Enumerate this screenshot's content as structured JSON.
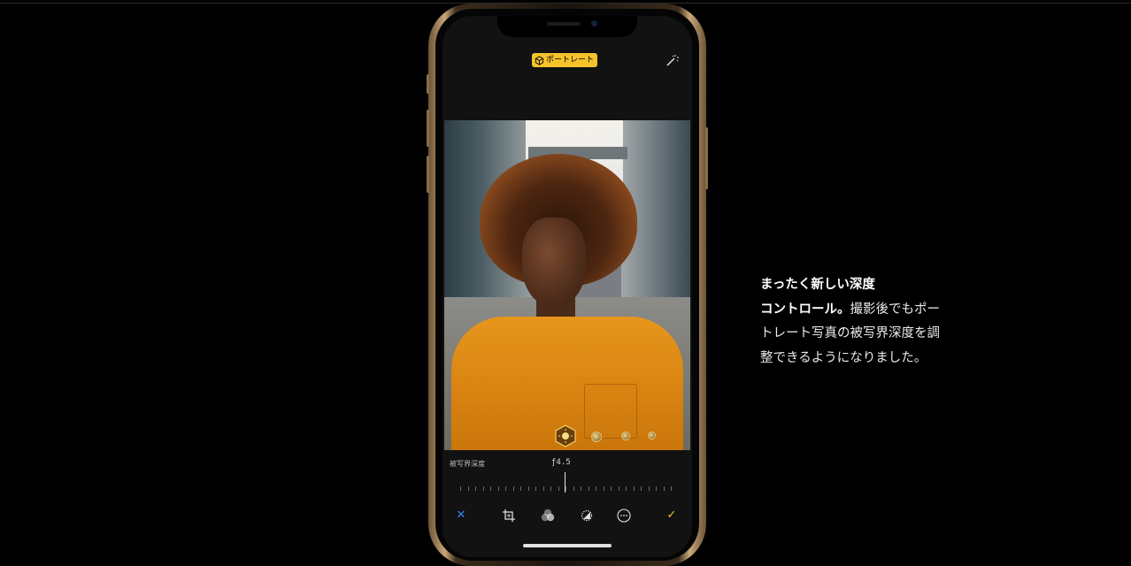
{
  "viewer": {
    "mode_badge": "ポートレート",
    "auto_enhance_icon": "magic-wand-icon",
    "lighting_selected": "natural-light-icon",
    "depth_label": "被写界深度",
    "fstop_value": "ƒ4.5",
    "toolbar": {
      "cancel": "✕",
      "crop": "crop-icon",
      "filters": "filters-icon",
      "adjust": "adjust-icon",
      "more": "more-icon",
      "done": "✓"
    }
  },
  "caption": {
    "line1_bold": "まったく新しい深度",
    "line2_bold": "コントロール。",
    "line2_rest": "撮影後でもポー",
    "line3": "トレート写真の被写界深度を調",
    "line4": "整できるようになりました。"
  },
  "colors": {
    "accent_yellow": "#f5c32a",
    "accent_blue": "#3b82f6"
  }
}
